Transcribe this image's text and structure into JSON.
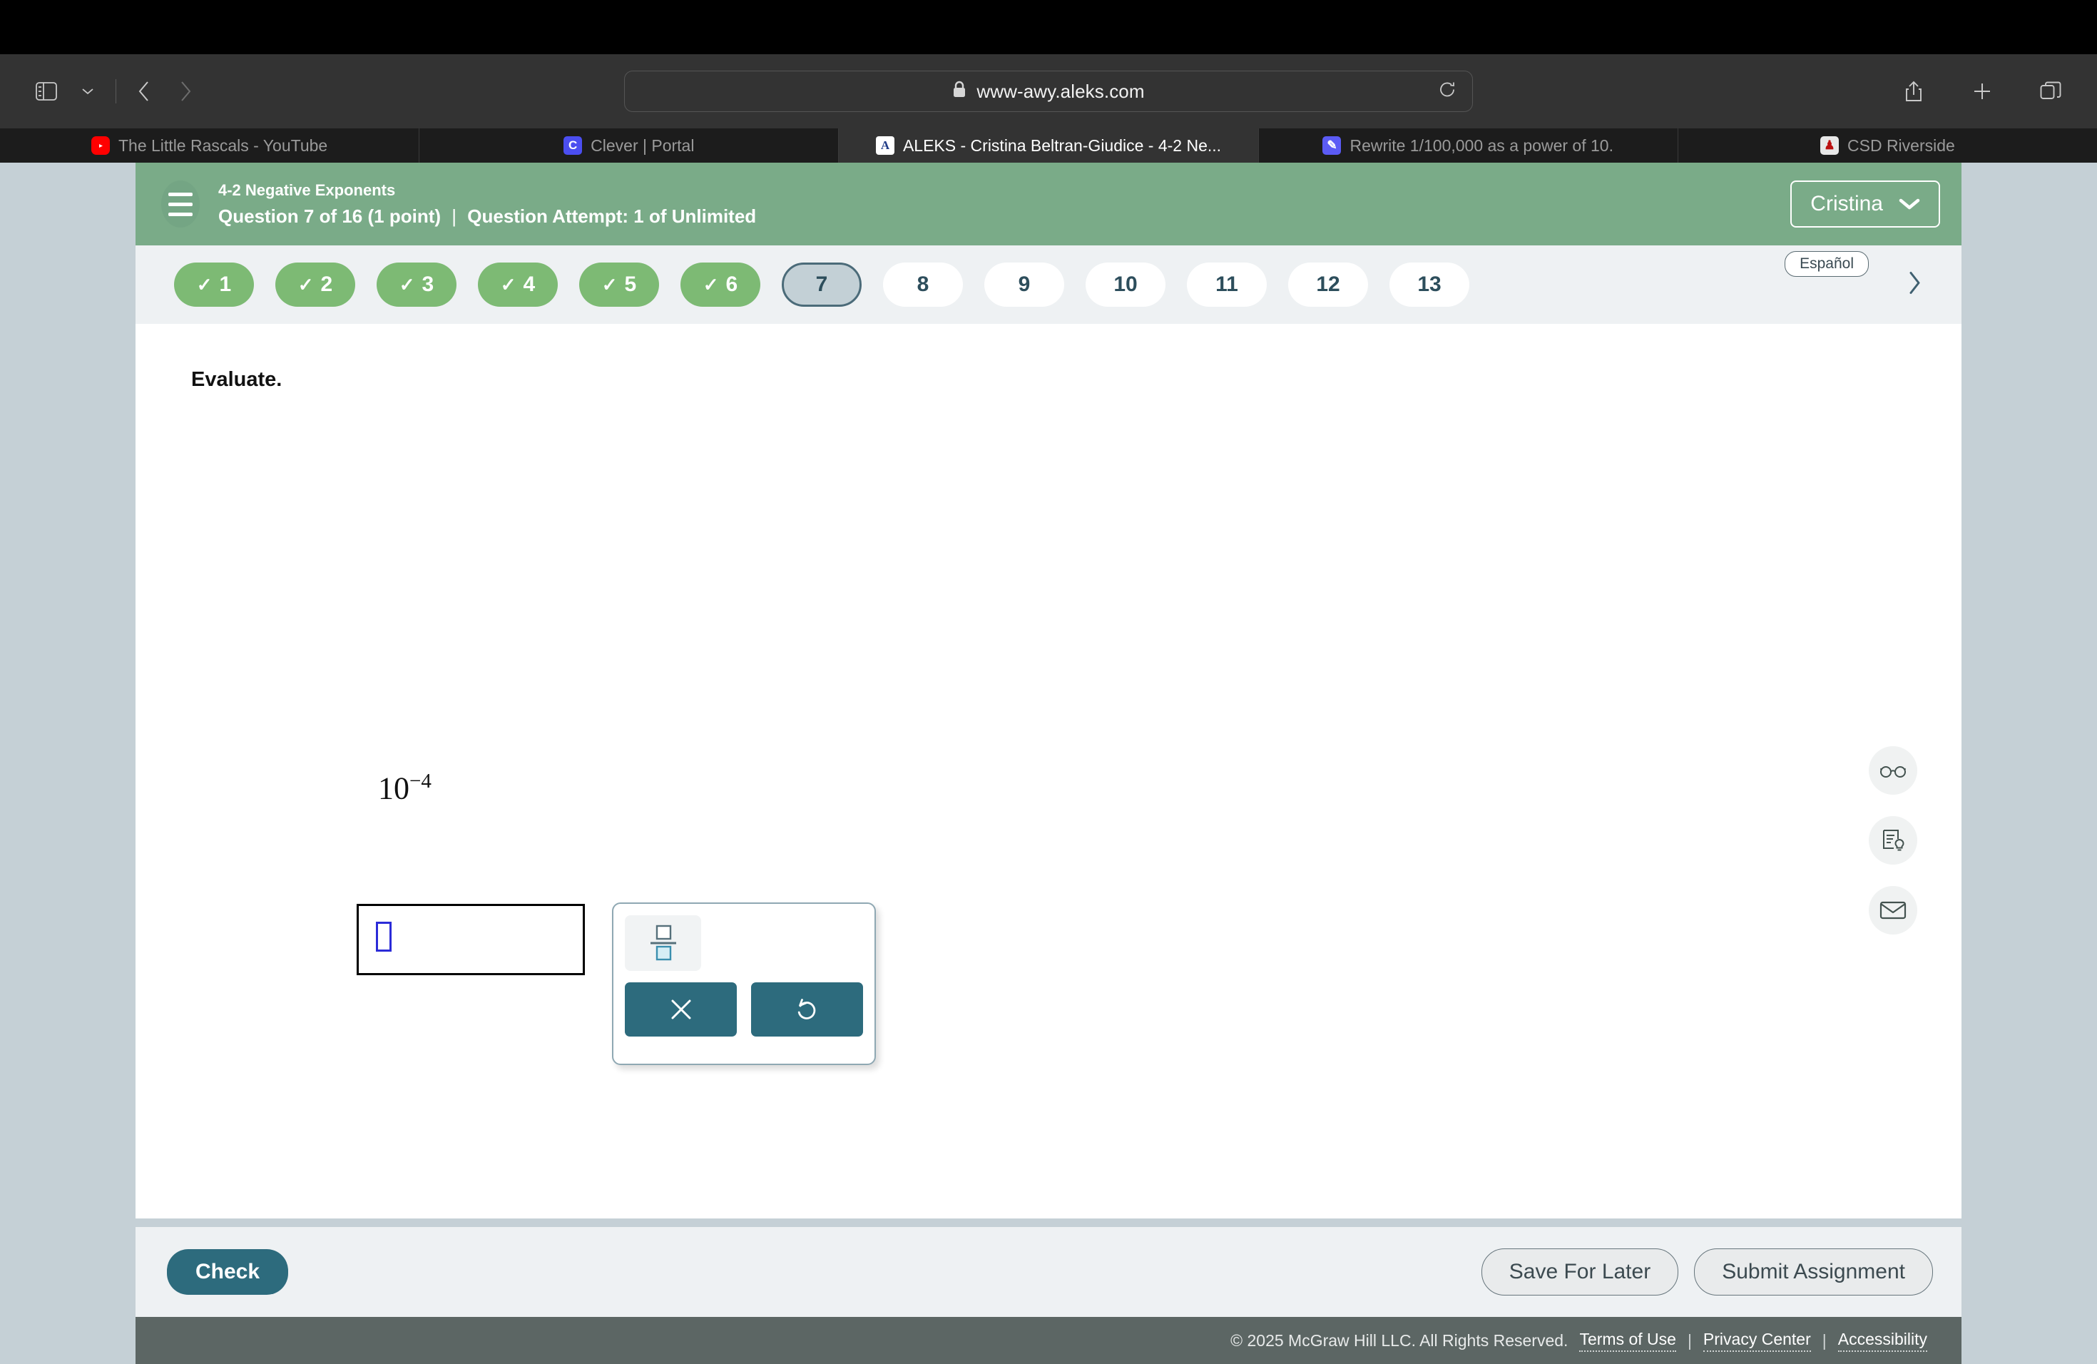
{
  "browser": {
    "url": "www-awy.aleks.com",
    "lock_icon": "lock-icon",
    "sidebar_icon": "sidebar-toggle-icon",
    "back_icon": "back-arrow-icon",
    "forward_icon": "forward-arrow-icon",
    "reload_icon": "reload-icon",
    "share_icon": "share-icon",
    "newtab_icon": "plus-icon",
    "tabs_overview_icon": "tab-overview-icon",
    "tabs": [
      {
        "label": "The Little Rascals - YouTube",
        "favicon": "youtube-icon",
        "favicon_char": "▶",
        "active": false
      },
      {
        "label": "Clever | Portal",
        "favicon": "clever-icon",
        "favicon_char": "C",
        "active": false
      },
      {
        "label": "ALEKS - Cristina Beltran-Giudice - 4-2 Ne...",
        "favicon": "aleks-icon",
        "favicon_char": "A",
        "active": true
      },
      {
        "label": "Rewrite 1/100,000 as a power of 10.",
        "favicon": "google-docs-icon",
        "favicon_char": "✎",
        "active": false
      },
      {
        "label": "CSD Riverside",
        "favicon": "csd-riverside-icon",
        "favicon_char": "♟",
        "active": false
      }
    ]
  },
  "header": {
    "assignment_title": "4-2 Negative Exponents",
    "question_label": "Question 7 of 16 (1 point)",
    "separator": "|",
    "attempt_label": "Question Attempt: 1 of Unlimited",
    "user_name": "Cristina",
    "menu_icon": "hamburger-menu-icon",
    "chevron_icon": "chevron-down-icon"
  },
  "question_nav": {
    "espanol_label": "Español",
    "next_icon": "chevron-right-icon",
    "check_glyph": "✓",
    "pills": [
      {
        "number": "1",
        "state": "done"
      },
      {
        "number": "2",
        "state": "done"
      },
      {
        "number": "3",
        "state": "done"
      },
      {
        "number": "4",
        "state": "done"
      },
      {
        "number": "5",
        "state": "done"
      },
      {
        "number": "6",
        "state": "done"
      },
      {
        "number": "7",
        "state": "current"
      },
      {
        "number": "8",
        "state": "todo"
      },
      {
        "number": "9",
        "state": "todo"
      },
      {
        "number": "10",
        "state": "todo"
      },
      {
        "number": "11",
        "state": "todo"
      },
      {
        "number": "12",
        "state": "todo"
      },
      {
        "number": "13",
        "state": "todo"
      }
    ]
  },
  "question": {
    "prompt": "Evaluate.",
    "expression_base": "10",
    "expression_exponent": "−4",
    "answer_value": ""
  },
  "math_palette": {
    "fraction_icon": "fraction-template-icon",
    "clear_icon": "clear-x-icon",
    "undo_icon": "undo-icon"
  },
  "tools": [
    {
      "icon": "glasses-icon",
      "name": "review-tool"
    },
    {
      "icon": "explanation-icon",
      "name": "explanation-tool"
    },
    {
      "icon": "mail-icon",
      "name": "message-tool"
    }
  ],
  "actions": {
    "check_label": "Check",
    "save_label": "Save For Later",
    "submit_label": "Submit Assignment"
  },
  "footer": {
    "copyright": "© 2025 McGraw Hill LLC. All Rights Reserved.",
    "terms": "Terms of Use",
    "privacy": "Privacy Center",
    "accessibility": "Accessibility",
    "separator": "|"
  },
  "colors": {
    "header_green": "#7aab88",
    "pill_done": "#7dba74",
    "teal_accent": "#2d6b7d",
    "nav_background": "#eef1f3",
    "footer_gray": "#5c6664"
  }
}
